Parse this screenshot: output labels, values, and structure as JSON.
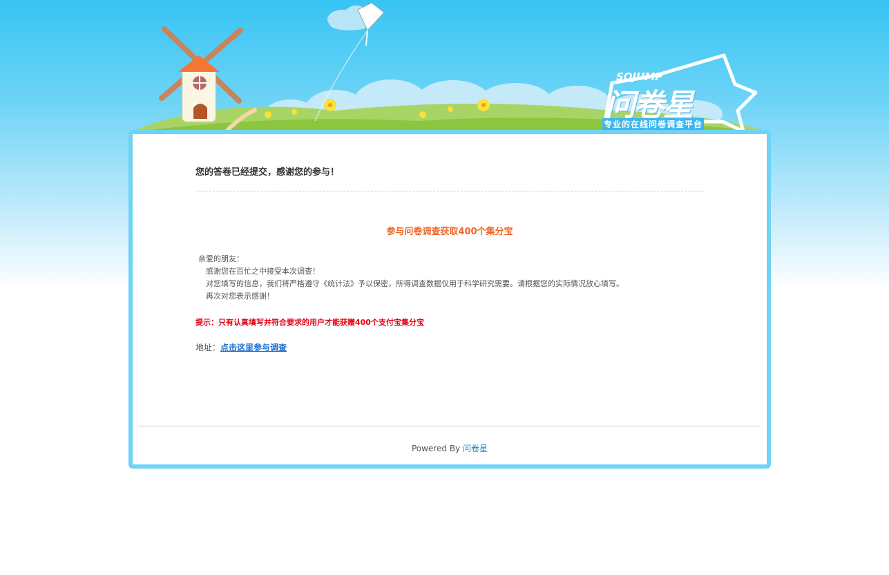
{
  "header": {
    "logo_top": "SOJUMP",
    "logo_main": "问卷星",
    "logo_slogan": "专业的在线问卷调查平台"
  },
  "main": {
    "title": "您的答卷已经提交，感谢您的参与！",
    "promo_heading": "参与问卷调查获取400个集分宝",
    "greeting": "亲爱的朋友：",
    "lines": [
      "感谢您在百忙之中接受本次调查！",
      "对您填写的信息，我们将严格遵守《统计法》予以保密，所得调查数据仅用于科学研究需要。请根据您的实际情况放心填写。",
      "再次对您表示感谢！"
    ],
    "tip": "提示：只有认真填写并符合要求的用户才能获赠400个支付宝集分宝",
    "address_label": "地址：",
    "address_link": "点击这里参与调查"
  },
  "footer": {
    "powered_by": "Powered By",
    "brand_link": "问卷星"
  },
  "colors": {
    "accent_orange": "#f26522",
    "tip_red": "#e60012",
    "link_blue": "#1c6fd1",
    "frame_blue": "#6fd3f3"
  }
}
